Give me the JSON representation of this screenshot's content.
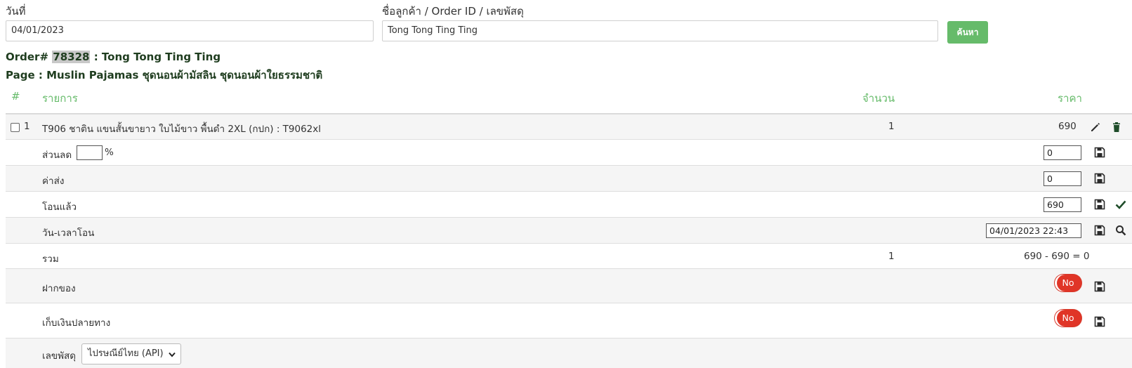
{
  "search": {
    "date_label": "วันที่",
    "date_value": "04/01/2023",
    "customer_label": "ชื่อลูกค้า / Order ID / เลขพัสดุ",
    "customer_value": "Tong Tong Ting Ting",
    "button_label": "ค้นหา"
  },
  "order": {
    "prefix": "Order#",
    "id": "78328",
    "customer": ": Tong Tong Ting Ting",
    "page_line": "Page : Muslin Pajamas ชุดนอนผ้ามัสลิน ชุดนอนผ้าใยธรรมชาติ"
  },
  "table": {
    "headers": {
      "num": "#",
      "item": "รายการ",
      "qty": "จำนวน",
      "price": "ราคา"
    },
    "items": [
      {
        "num": "1",
        "name": "T906 ชาติน แขนสั้นขายาว ใบไม้ขาว พื้นดำ 2XL (กปก) : T9062xl",
        "qty": "1",
        "price": "690"
      }
    ],
    "discount": {
      "label": "ส่วนลด",
      "percent_value": "",
      "percent_sign": "%",
      "value": "0"
    },
    "shipping": {
      "label": "ค่าส่ง",
      "value": "0"
    },
    "transferred": {
      "label": "โอนแล้ว",
      "value": "690"
    },
    "transfer_datetime": {
      "label": "วัน-เวลาโอน",
      "value": "04/01/2023 22:43"
    },
    "total": {
      "label": "รวม",
      "qty": "1",
      "value": "690 - 690 = 0"
    },
    "deposit": {
      "label": "ฝากของ",
      "toggle": "No"
    },
    "cod": {
      "label": "เก็บเงินปลายทาง",
      "toggle": "No"
    },
    "tracking": {
      "label": "เลขพัสดุ",
      "carrier": "ไปรษณีย์ไทย (API)"
    }
  },
  "colors": {
    "accent_green": "#66bb6a",
    "toggle_red": "#e03527",
    "row_alt": "#f5f5f5"
  }
}
